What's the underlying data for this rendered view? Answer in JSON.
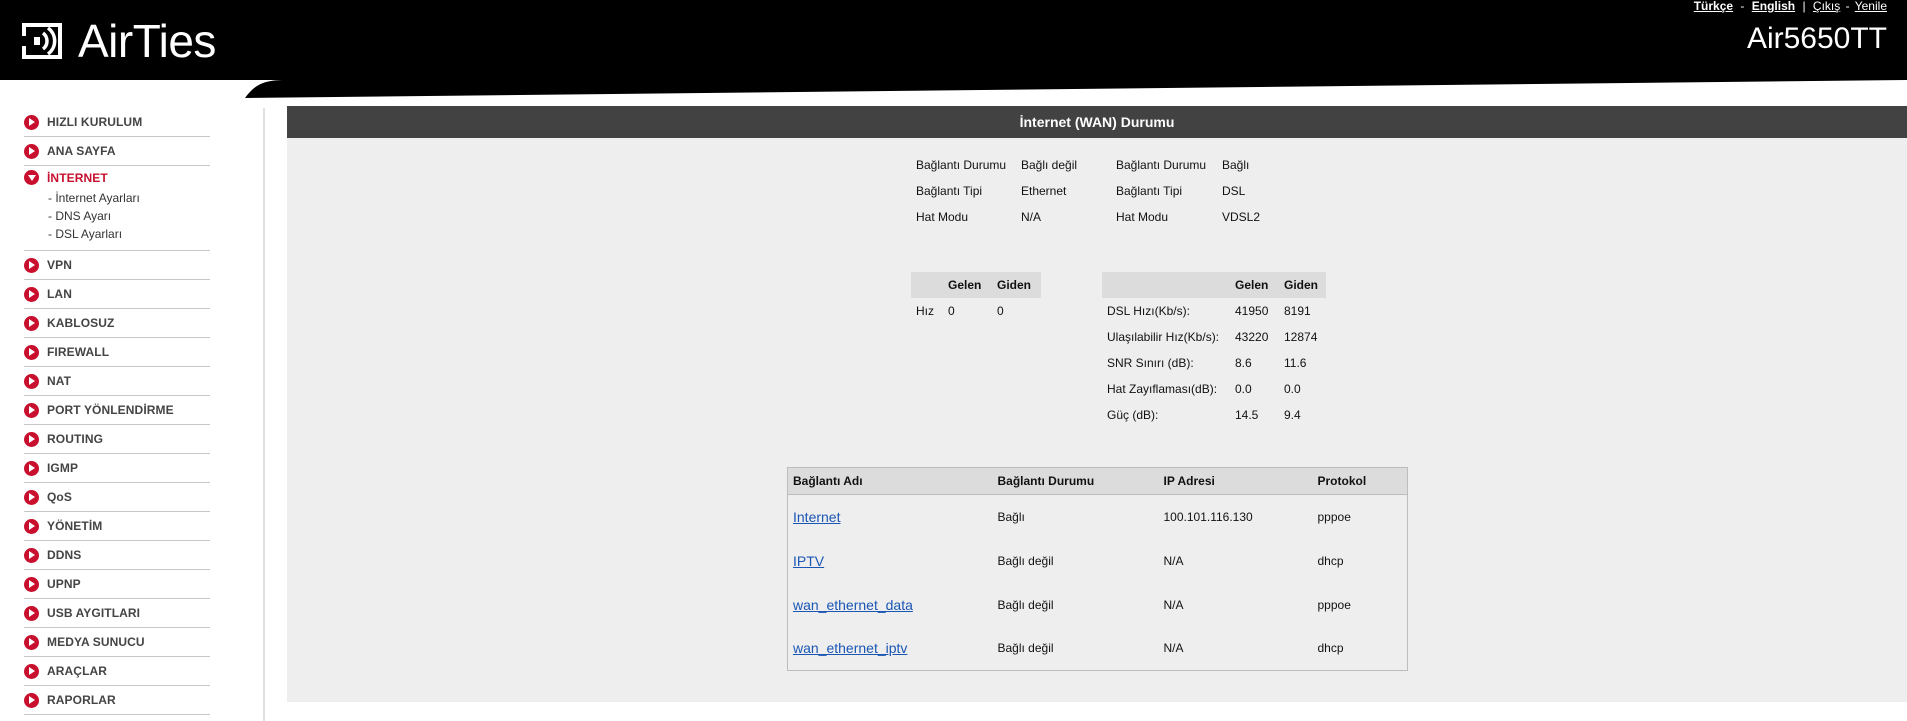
{
  "header": {
    "brand": "AirTies",
    "model": "Air5650TT",
    "links": {
      "turkish": "Türkçe",
      "english": "English",
      "logout": "Çıkış",
      "refresh": "Yenile"
    }
  },
  "sidebar": {
    "items": [
      {
        "label": "HIZLI KURULUM"
      },
      {
        "label": "ANA SAYFA"
      },
      {
        "label": "İNTERNET",
        "active": true,
        "subitems": [
          "- İnternet Ayarları",
          "- DNS Ayarı",
          "- DSL Ayarları"
        ]
      },
      {
        "label": "VPN"
      },
      {
        "label": "LAN"
      },
      {
        "label": "KABLOSUZ"
      },
      {
        "label": "FIREWALL"
      },
      {
        "label": "NAT"
      },
      {
        "label": "PORT YÖNLENDİRME"
      },
      {
        "label": "ROUTING"
      },
      {
        "label": "IGMP"
      },
      {
        "label": "QoS"
      },
      {
        "label": "YÖNETİM"
      },
      {
        "label": "DDNS"
      },
      {
        "label": "UPNP"
      },
      {
        "label": "USB AYGITLARI"
      },
      {
        "label": "MEDYA SUNUCU"
      },
      {
        "label": "ARAÇLAR"
      },
      {
        "label": "RAPORLAR"
      }
    ]
  },
  "panel": {
    "title": "İnternet (WAN) Durumu",
    "ethernet_status": {
      "rows": [
        {
          "label": "Bağlantı Durumu",
          "value": "Bağlı değil"
        },
        {
          "label": "Bağlantı Tipi",
          "value": "Ethernet"
        },
        {
          "label": "Hat Modu",
          "value": "N/A"
        }
      ]
    },
    "dsl_status": {
      "rows": [
        {
          "label": "Bağlantı Durumu",
          "value": "Bağlı"
        },
        {
          "label": "Bağlantı Tipi",
          "value": "DSL"
        },
        {
          "label": "Hat Modu",
          "value": "VDSL2"
        }
      ]
    },
    "ethernet_speed": {
      "headers": [
        "",
        "Gelen",
        "Giden"
      ],
      "rows": [
        {
          "label": "Hız",
          "in": "0",
          "out": "0"
        }
      ]
    },
    "dsl_speed": {
      "headers": [
        "",
        "Gelen",
        "Giden"
      ],
      "rows": [
        {
          "label": "DSL Hızı(Kb/s):",
          "in": "41950",
          "out": "8191"
        },
        {
          "label": "Ulaşılabilir Hız(Kb/s):",
          "in": "43220",
          "out": "12874"
        },
        {
          "label": "SNR Sınırı (dB):",
          "in": "8.6",
          "out": "11.6"
        },
        {
          "label": "Hat Zayıflaması(dB):",
          "in": "0.0",
          "out": "0.0"
        },
        {
          "label": "Güç (dB):",
          "in": "14.5",
          "out": "9.4"
        }
      ]
    },
    "connections": {
      "headers": [
        "Bağlantı Adı",
        "Bağlantı Durumu",
        "IP Adresi",
        "Protokol"
      ],
      "rows": [
        {
          "name": "Internet",
          "status": "Bağlı",
          "ip": "100.101.116.130",
          "protocol": "pppoe"
        },
        {
          "name": "IPTV",
          "status": "Bağlı değil",
          "ip": "N/A",
          "protocol": "dhcp"
        },
        {
          "name": "wan_ethernet_data",
          "status": "Bağlı değil",
          "ip": "N/A",
          "protocol": "pppoe"
        },
        {
          "name": "wan_ethernet_iptv",
          "status": "Bağlı değil",
          "ip": "N/A",
          "protocol": "dhcp"
        }
      ]
    }
  }
}
